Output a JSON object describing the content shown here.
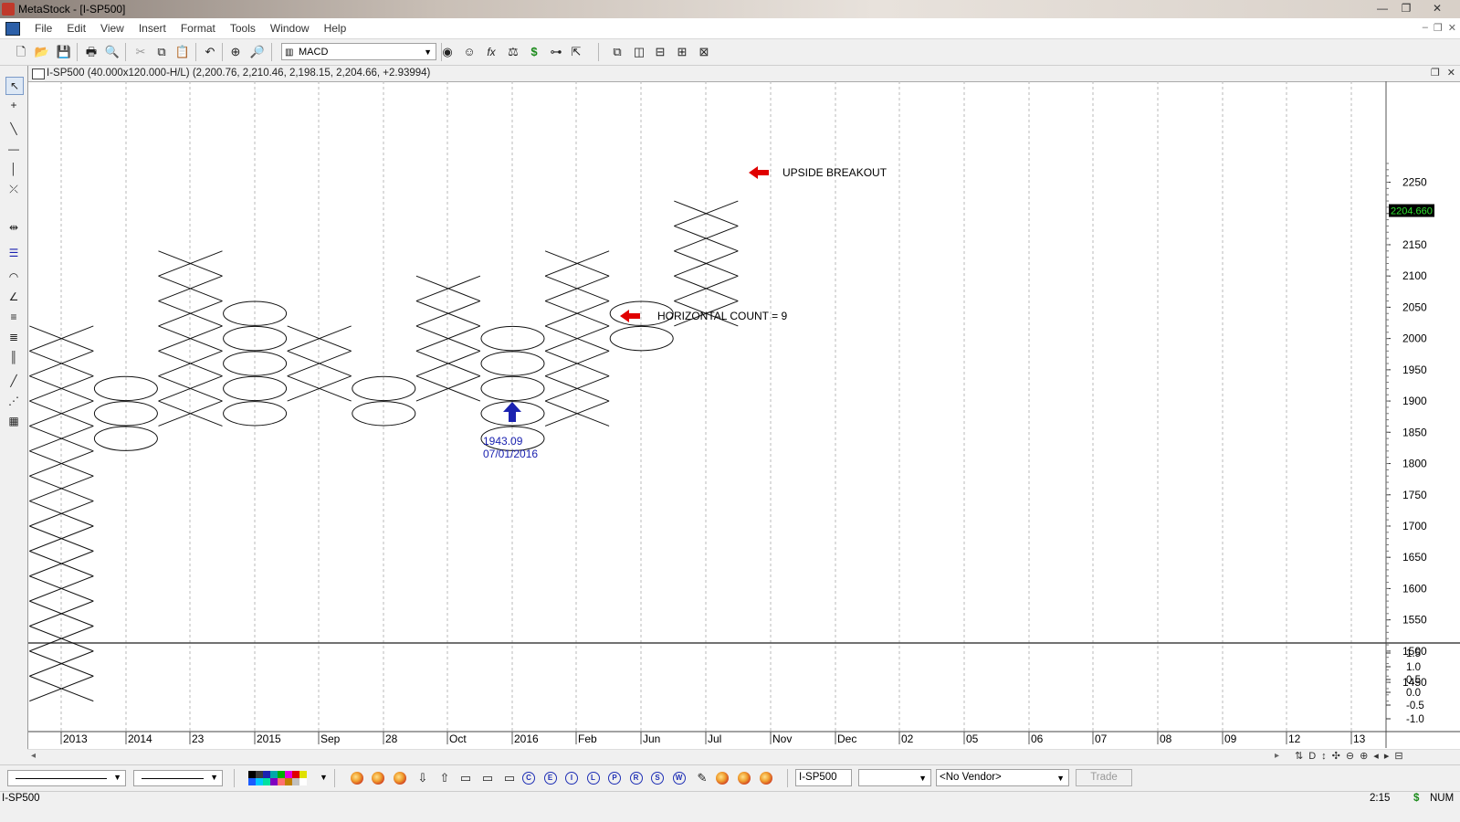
{
  "window": {
    "title": "MetaStock - [I-SP500]",
    "minimize": "—",
    "restore": "❐",
    "close": "✕",
    "mdi_minimize": "–",
    "mdi_restore": "❐",
    "mdi_close": "✕"
  },
  "menu": [
    "File",
    "Edit",
    "View",
    "Insert",
    "Format",
    "Tools",
    "Window",
    "Help"
  ],
  "toolbar": {
    "indicator_combo": "MACD",
    "dollar_glyph": "$"
  },
  "chart_window": {
    "caption": "I-SP500 (40.000x120.000-H/L) (2,200.76, 2,210.46, 2,198.15, 2,204.66, +2.93994)",
    "maximize": "❐",
    "close": "✕"
  },
  "chart_data": {
    "type": "point-and-figure",
    "box_size": 40,
    "reversal": 120,
    "price_axis": {
      "ticks": [
        2250,
        2200,
        2150,
        2100,
        2050,
        2000,
        1950,
        1900,
        1850,
        1800,
        1750,
        1700,
        1650,
        1600,
        1550,
        1500,
        1450
      ],
      "range": [
        1410,
        2285
      ],
      "current_price_label": "2204.660"
    },
    "indicator_axis": {
      "ticks": [
        "1.5",
        "1.0",
        "0.5",
        "0.0",
        "-0.5",
        "-1.0"
      ]
    },
    "date_labels": [
      "2013",
      "2014",
      "23",
      "2015",
      "Sep",
      "28",
      "Oct",
      "2016",
      "Feb",
      "Jun",
      "Jul",
      "Nov",
      "Dec",
      "02",
      "05",
      "06",
      "07",
      "08",
      "09",
      "12",
      "13"
    ],
    "columns": [
      {
        "type": "X",
        "low": 1420,
        "high": 2000
      },
      {
        "type": "O",
        "low": 1820,
        "high": 1940
      },
      {
        "type": "X",
        "low": 1860,
        "high": 2140
      },
      {
        "type": "O",
        "low": 1860,
        "high": 2060
      },
      {
        "type": "X",
        "low": 1900,
        "high": 2000
      },
      {
        "type": "O",
        "low": 1860,
        "high": 1940
      },
      {
        "type": "X",
        "low": 1900,
        "high": 2100
      },
      {
        "type": "O",
        "low": 1820,
        "high": 2020
      },
      {
        "type": "X",
        "low": 1860,
        "high": 2140
      },
      {
        "type": "O",
        "low": 1980,
        "high": 2060
      },
      {
        "type": "X",
        "low": 2020,
        "high": 2220
      }
    ],
    "annotations": [
      {
        "text": "UPSIDE BREAKOUT",
        "price": 2150,
        "arrow": "left",
        "color": "#e00000"
      },
      {
        "text": "HORIZONTAL COUNT = 9",
        "price": 1920,
        "arrow": "left",
        "color": "#e00000"
      },
      {
        "text_line1": "1943.09",
        "text_line2": "07/01/2016",
        "arrow": "up",
        "color": "#1b22b0"
      }
    ]
  },
  "bottom_toolbar": {
    "circle_buttons": [
      "C",
      "E",
      "I",
      "L",
      "P",
      "R",
      "S",
      "W"
    ],
    "symbol_input": "I-SP500",
    "vendor_select": "<No Vendor>",
    "trade_button": "Trade"
  },
  "palette_colors": [
    "#000000",
    "#3a3a3a",
    "#1b22b0",
    "#00a8a8",
    "#00b000",
    "#e000e0",
    "#e00000",
    "#e0e000",
    "#1b5cff",
    "#00c8ff",
    "#00e0a0",
    "#8000c0",
    "#ff7070",
    "#c08000",
    "#c0c0c0",
    "#ffffff"
  ],
  "status": {
    "symbol": "I-SP500",
    "time": "2:15",
    "dollar": "$",
    "num": "NUM"
  }
}
